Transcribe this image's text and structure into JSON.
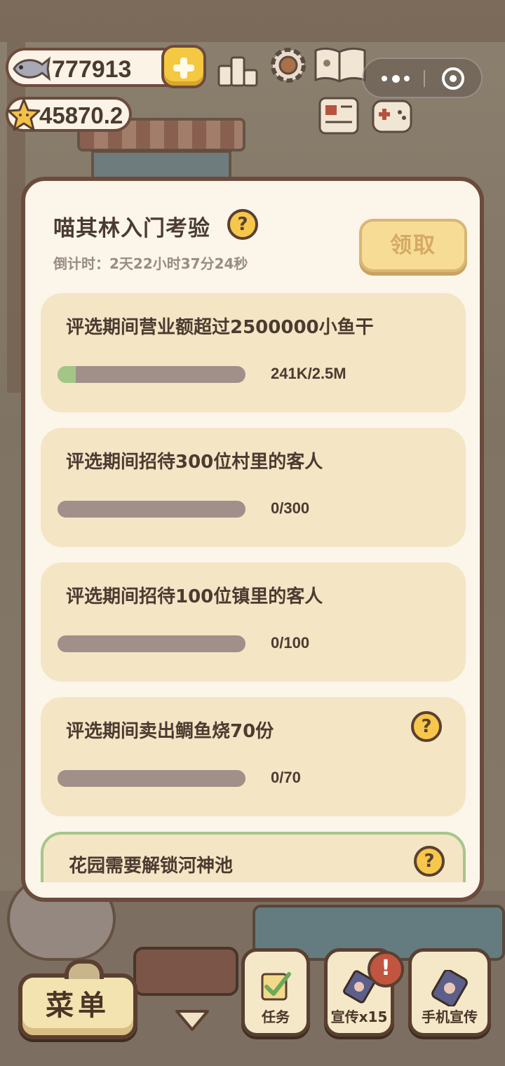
{
  "hud": {
    "fish_amount": "777913",
    "star_amount": "45870.2"
  },
  "panel": {
    "title": "喵其林入门考验",
    "help_glyph": "?",
    "countdown": "倒计时：2天22小时37分24秒",
    "claim_label": "领取"
  },
  "tasks": [
    {
      "label": "评选期间营业额超过2500000小鱼干",
      "progress_text": "241K/2.5M",
      "progress": 0.096
    },
    {
      "label": "评选期间招待300位村里的客人",
      "progress_text": "0/300",
      "progress": 0
    },
    {
      "label": "评选期间招待100位镇里的客人",
      "progress_text": "0/100",
      "progress": 0
    },
    {
      "label": "评选期间卖出鲷鱼烧70份",
      "progress_text": "0/70",
      "progress": 0
    },
    {
      "label": "花园需要解锁河神池"
    }
  ],
  "bottom": {
    "menu_label": "菜单",
    "task_label": "任务",
    "promo_label": "宣传x15",
    "phone_promo_label": "手机宣传",
    "alert_glyph": "!"
  },
  "colors": {
    "panel_bg": "#fbf5ea",
    "card_bg": "#f4e5c5",
    "progress_fill": "#a3c585",
    "help_yellow": "#f6c74a",
    "outline_brown": "#6b4b3d"
  },
  "icons": [
    "fish-icon",
    "plus-icon",
    "star-icon",
    "podium-icon",
    "gear-icon",
    "book-icon",
    "news-icon",
    "gamepad-icon",
    "help-icon",
    "checkmark-icon",
    "poster-icon",
    "phone-icon",
    "down-arrow-icon"
  ]
}
